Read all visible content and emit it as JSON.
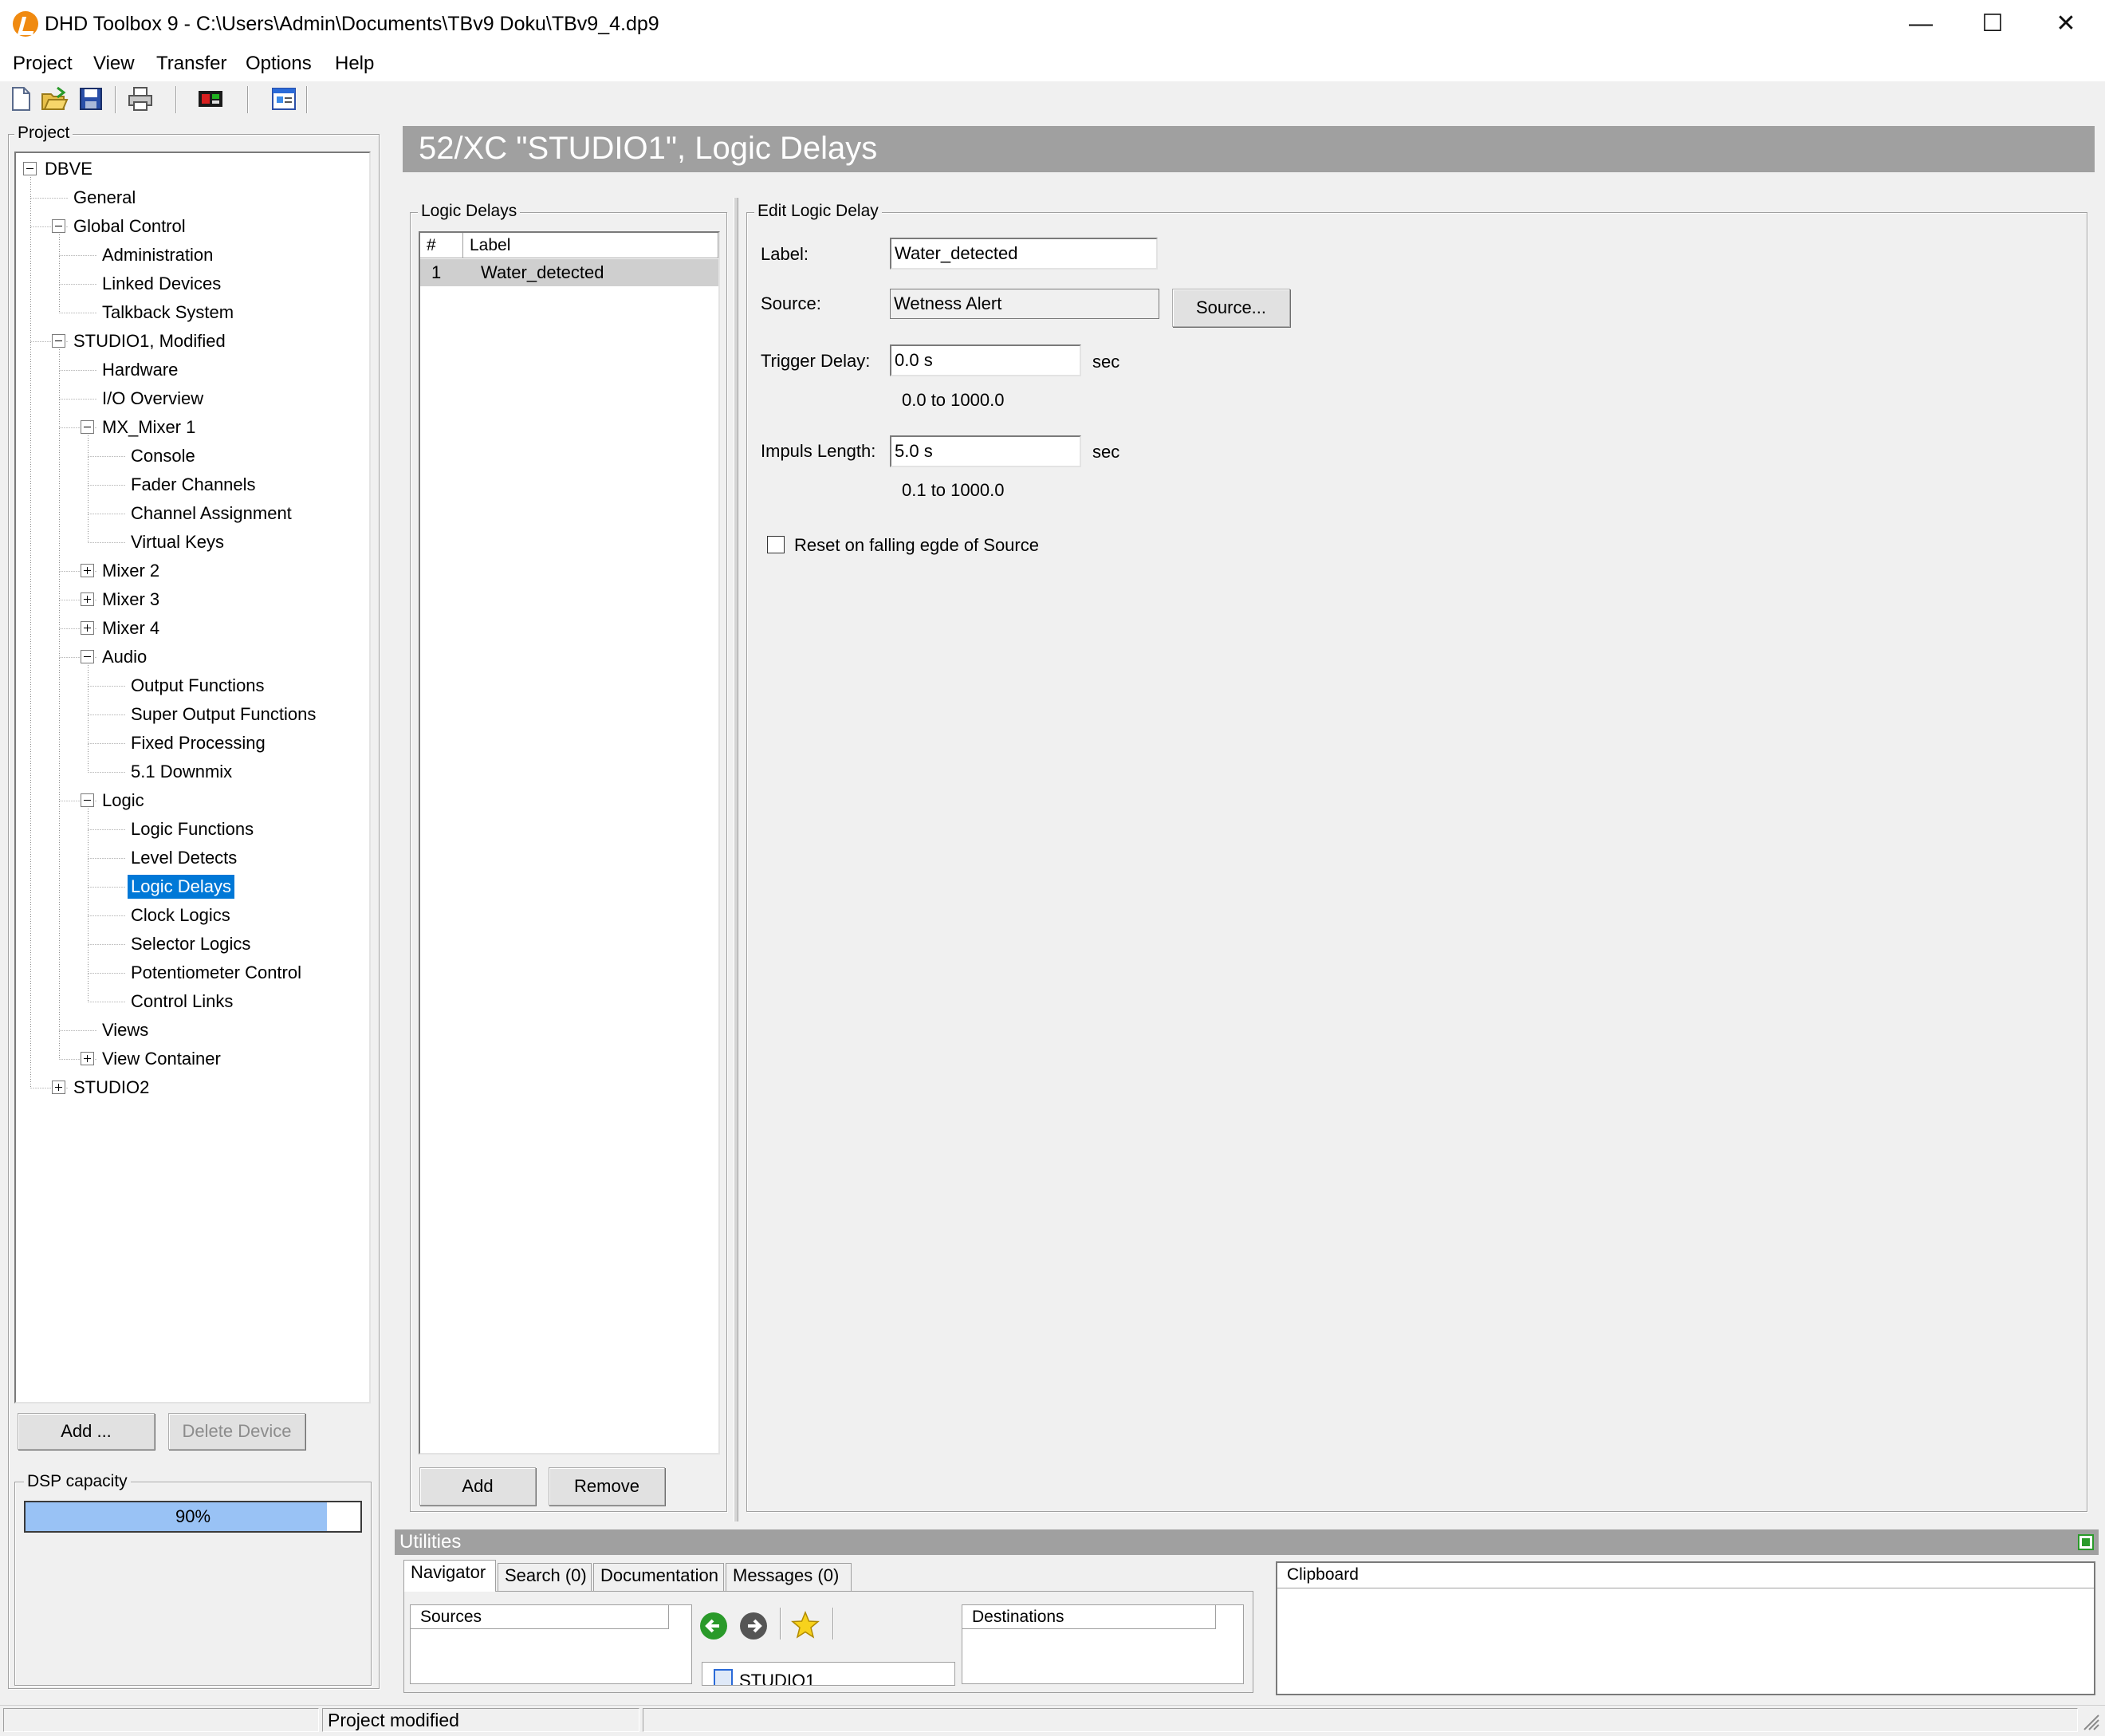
{
  "window": {
    "title": "DHD Toolbox 9 - C:\\Users\\Admin\\Documents\\TBv9 Doku\\TBv9_4.dp9",
    "minimize": "—",
    "maximize": "☐",
    "close": "✕"
  },
  "menu": [
    "Project",
    "View",
    "Transfer",
    "Options",
    "Help"
  ],
  "toolbar": {
    "icons": [
      "new-file-icon",
      "open-folder-icon",
      "save-icon",
      "print-icon",
      "device-icon",
      "properties-icon"
    ]
  },
  "project_panel": {
    "group_label": "Project",
    "tree": [
      {
        "label": "DBVE",
        "depth": 0,
        "expander": "minus"
      },
      {
        "label": "General",
        "depth": 1
      },
      {
        "label": "Global Control",
        "depth": 1,
        "expander": "minus"
      },
      {
        "label": "Administration",
        "depth": 2
      },
      {
        "label": "Linked Devices",
        "depth": 2
      },
      {
        "label": "Talkback System",
        "depth": 2
      },
      {
        "label": "STUDIO1, Modified",
        "depth": 1,
        "expander": "minus"
      },
      {
        "label": "Hardware",
        "depth": 2
      },
      {
        "label": "I/O Overview",
        "depth": 2
      },
      {
        "label": "MX_Mixer 1",
        "depth": 2,
        "expander": "minus"
      },
      {
        "label": "Console",
        "depth": 3
      },
      {
        "label": "Fader Channels",
        "depth": 3
      },
      {
        "label": "Channel Assignment",
        "depth": 3
      },
      {
        "label": "Virtual Keys",
        "depth": 3
      },
      {
        "label": "Mixer 2",
        "depth": 2,
        "expander": "plus"
      },
      {
        "label": "Mixer 3",
        "depth": 2,
        "expander": "plus"
      },
      {
        "label": "Mixer 4",
        "depth": 2,
        "expander": "plus"
      },
      {
        "label": "Audio",
        "depth": 2,
        "expander": "minus"
      },
      {
        "label": "Output Functions",
        "depth": 3
      },
      {
        "label": "Super Output Functions",
        "depth": 3
      },
      {
        "label": "Fixed Processing",
        "depth": 3
      },
      {
        "label": "5.1 Downmix",
        "depth": 3
      },
      {
        "label": "Logic",
        "depth": 2,
        "expander": "minus"
      },
      {
        "label": "Logic Functions",
        "depth": 3
      },
      {
        "label": "Level Detects",
        "depth": 3
      },
      {
        "label": "Logic Delays",
        "depth": 3,
        "selected": true
      },
      {
        "label": "Clock Logics",
        "depth": 3
      },
      {
        "label": "Selector Logics",
        "depth": 3
      },
      {
        "label": "Potentiometer Control",
        "depth": 3
      },
      {
        "label": "Control Links",
        "depth": 3
      },
      {
        "label": "Views",
        "depth": 2
      },
      {
        "label": "View Container",
        "depth": 2,
        "expander": "plus"
      },
      {
        "label": "STUDIO2",
        "depth": 1,
        "expander": "plus"
      }
    ],
    "add_button": "Add ...",
    "delete_button": "Delete Device",
    "dsp_label": "DSP capacity",
    "dsp_value": "90%",
    "dsp_fraction": 0.9
  },
  "header": {
    "title": "52/XC \"STUDIO1\", Logic Delays"
  },
  "logic_delays": {
    "group_label": "Logic Delays",
    "columns": [
      "#",
      "Label"
    ],
    "rows": [
      {
        "num": "1",
        "label": "Water_detected"
      }
    ],
    "add_button": "Add",
    "remove_button": "Remove"
  },
  "edit": {
    "group_label": "Edit Logic Delay",
    "label_caption": "Label:",
    "label_value": "Water_detected",
    "source_caption": "Source:",
    "source_value": "Wetness Alert",
    "source_button": "Source...",
    "trigger_caption": "Trigger Delay:",
    "trigger_value": "0.0 s",
    "trigger_unit": "sec",
    "trigger_range": "0.0 to 1000.0",
    "impulse_caption": "Impuls Length:",
    "impulse_value": "5.0 s",
    "impulse_unit": "sec",
    "impulse_range": "0.1 to 1000.0",
    "reset_checkbox": "Reset on falling egde of Source",
    "reset_checked": false
  },
  "utilities": {
    "title": "Utilities",
    "tabs": [
      "Navigator",
      "Search (0)",
      "Documentation",
      "Messages (0)"
    ],
    "active_tab": "Navigator",
    "sources_header": "Sources",
    "destinations_header": "Destinations",
    "nav_item": "STUDIO1",
    "clipboard_header": "Clipboard"
  },
  "statusbar": {
    "message": "Project modified"
  },
  "colors": {
    "accent": "#0078d7",
    "header_bg": "#a0a0a0",
    "dsp_bar": "#99c2f5"
  }
}
